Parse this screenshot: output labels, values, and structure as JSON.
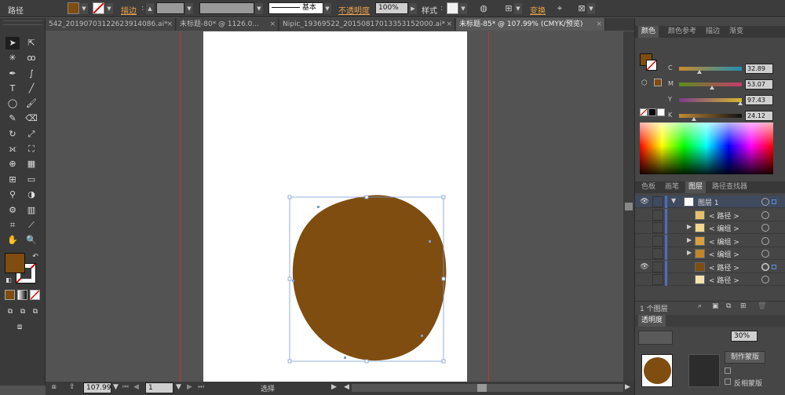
{
  "control_bar": {
    "selection_type": "路径",
    "fill_color": "#7f4d0f",
    "stroke_label": "描边",
    "stroke_style_label": "基本",
    "opacity_label": "不透明度",
    "opacity_value": "100%",
    "style_label": "样式",
    "transform_label": "变换"
  },
  "tabs": [
    {
      "label": "542_20190703122623914086.ai*"
    },
    {
      "label": "未标题-80* @ 1126.0..."
    },
    {
      "label": "Nipic_19369522_20150817013353152000.ai*"
    },
    {
      "label": "未标题-85* @ 107.99% (CMYK/预览)"
    }
  ],
  "close_glyph": "×",
  "canvas": {
    "shape_color": "#7f4d0f"
  },
  "status": {
    "zoom": "107.99",
    "artboard_no": "1",
    "mode": "选择"
  },
  "color_panel": {
    "tabs": [
      "颜色",
      "颜色参考",
      "描边",
      "渐变"
    ],
    "channels": [
      {
        "label": "C",
        "value": "32.89",
        "pct": 0.33,
        "grad": "linear-gradient(90deg,#c98a2c,#1f8fb0)"
      },
      {
        "label": "M",
        "value": "53.07",
        "pct": 0.53,
        "grad": "linear-gradient(90deg,#5a8d1f,#c63b6b)"
      },
      {
        "label": "Y",
        "value": "97.43",
        "pct": 0.97,
        "grad": "linear-gradient(90deg,#7a3a8e,#d4b82a)"
      },
      {
        "label": "K",
        "value": "24.12",
        "pct": 0.24,
        "grad": "linear-gradient(90deg,#c08a36,#111)"
      }
    ]
  },
  "layers_panel": {
    "tabs": [
      "色板",
      "画笔",
      "图层",
      "路径查找器"
    ],
    "layers": [
      {
        "name": "图层 1",
        "level": 0,
        "eye": true,
        "thumb": "#ffffff"
      },
      {
        "name": "< 路径 >",
        "level": 1,
        "eye": false,
        "thumb": "#e6c16a"
      },
      {
        "name": "< 编组 >",
        "level": 1,
        "eye": false,
        "thumb": "#f0d890",
        "group": true
      },
      {
        "name": "< 编组 >",
        "level": 1,
        "eye": false,
        "thumb": "#d9a040",
        "group": true
      },
      {
        "name": "< 编组 >",
        "level": 1,
        "eye": false,
        "thumb": "#c0862c",
        "group": true
      },
      {
        "name": "< 路径 >",
        "level": 1,
        "eye": true,
        "thumb": "#7f4d0f",
        "selected": true
      },
      {
        "name": "< 路径 >",
        "level": 1,
        "eye": false,
        "thumb": "#f4e2b0"
      }
    ],
    "footer": "1 个图层"
  },
  "transparency_panel": {
    "title": "透明度",
    "opacity_value": "30%",
    "make_mask": "制作蒙版",
    "invert_mask": "反相蒙版"
  }
}
